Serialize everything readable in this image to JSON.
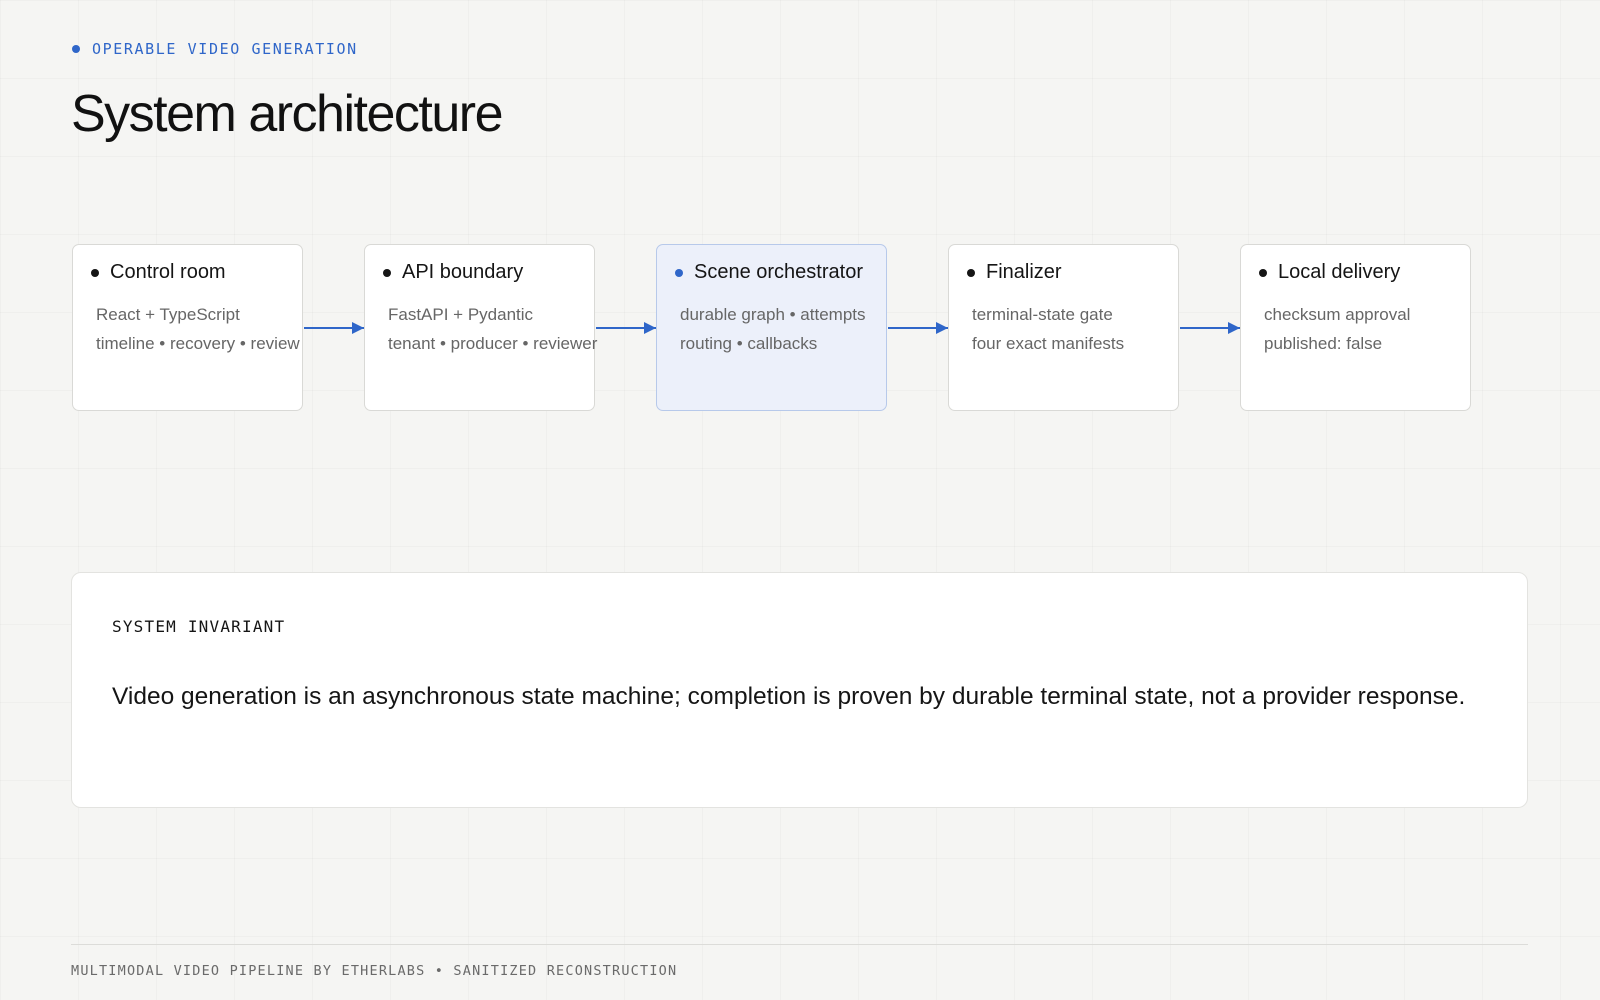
{
  "header": {
    "eyebrow": "OPERABLE VIDEO GENERATION",
    "title": "System architecture"
  },
  "diagram": {
    "nodes": [
      {
        "title": "Control room",
        "lines": [
          "React + TypeScript",
          "timeline • recovery • review"
        ],
        "highlighted": false
      },
      {
        "title": "API boundary",
        "lines": [
          "FastAPI + Pydantic",
          "tenant • producer • reviewer"
        ],
        "highlighted": false
      },
      {
        "title": "Scene orchestrator",
        "lines": [
          "durable graph • attempts",
          "routing • callbacks"
        ],
        "highlighted": true
      },
      {
        "title": "Finalizer",
        "lines": [
          "terminal-state gate",
          "four exact manifests"
        ],
        "highlighted": false
      },
      {
        "title": "Local delivery",
        "lines": [
          "checksum approval",
          "published: false"
        ],
        "highlighted": false
      }
    ],
    "edges": [
      {
        "from": "Control room",
        "to": "API boundary"
      },
      {
        "from": "API boundary",
        "to": "Scene orchestrator"
      },
      {
        "from": "Scene orchestrator",
        "to": "Finalizer"
      },
      {
        "from": "Finalizer",
        "to": "Local delivery"
      }
    ]
  },
  "invariant": {
    "label": "SYSTEM INVARIANT",
    "text": "Video generation is an asynchronous state machine; completion is proven by durable terminal state, not a provider response."
  },
  "footer": {
    "text": "MULTIMODAL VIDEO PIPELINE BY ETHERLABS • SANITIZED RECONSTRUCTION"
  },
  "colors": {
    "accent": "#2f66c9",
    "highlight_fill": "#ecf0fa",
    "highlight_border": "#b7c9ea",
    "background": "#f5f5f3"
  }
}
